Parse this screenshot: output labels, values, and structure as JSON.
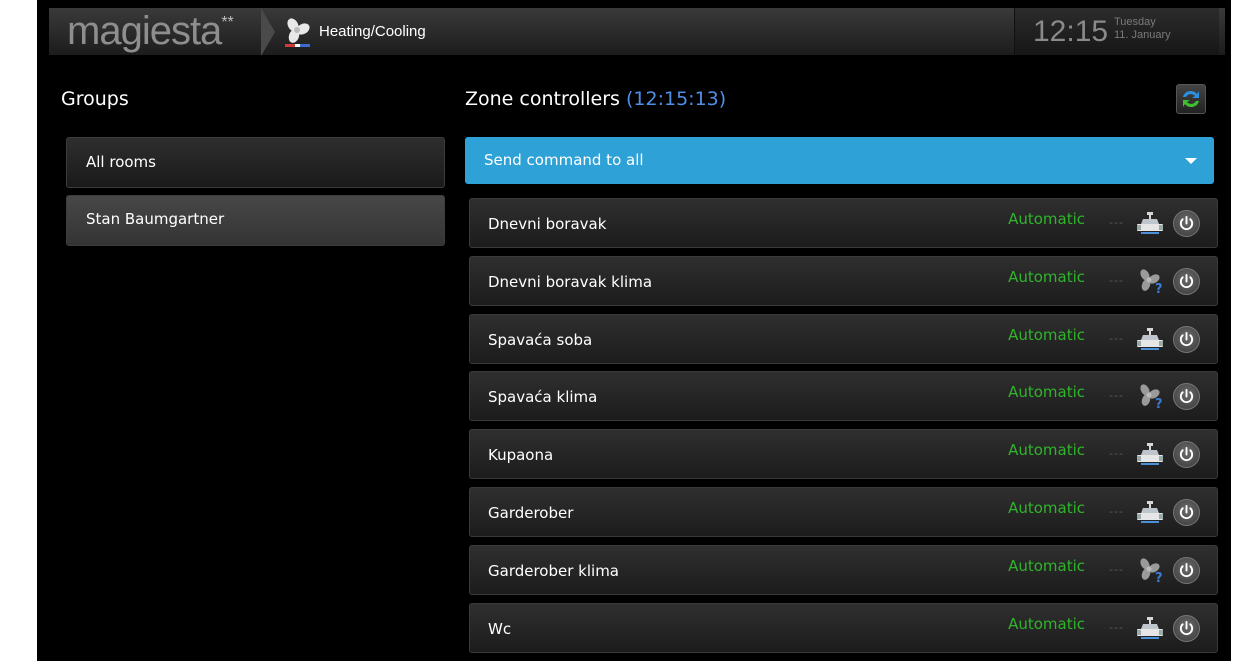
{
  "header": {
    "logo_text": "magiesta",
    "logo_stars": "**",
    "section_title": "Heating/Cooling",
    "section_icon": "fan-icon",
    "clock": {
      "time": "12:15",
      "day": "Tuesday",
      "date": "11. January"
    }
  },
  "groups": {
    "title": "Groups",
    "items": [
      {
        "label": "All rooms",
        "active": false
      },
      {
        "label": "Stan Baumgartner",
        "active": true
      }
    ]
  },
  "zones": {
    "title": "Zone controllers",
    "time": "(12:15:13)",
    "refresh_icon": "refresh-icon",
    "send_all_label": "Send command to all",
    "dashes": "---",
    "status_color": "#2fb42a",
    "items": [
      {
        "name": "Dnevni boravak",
        "status": "Automatic",
        "device": "valve-icon"
      },
      {
        "name": "Dnevni boravak klima",
        "status": "Automatic",
        "device": "fan-unknown-icon"
      },
      {
        "name": "Spavaća soba",
        "status": "Automatic",
        "device": "valve-icon"
      },
      {
        "name": "Spavaća klima",
        "status": "Automatic",
        "device": "fan-unknown-icon"
      },
      {
        "name": "Kupaona",
        "status": "Automatic",
        "device": "valve-icon"
      },
      {
        "name": "Garderober",
        "status": "Automatic",
        "device": "valve-icon"
      },
      {
        "name": "Garderober klima",
        "status": "Automatic",
        "device": "fan-unknown-icon"
      },
      {
        "name": "Wc",
        "status": "Automatic",
        "device": "valve-icon"
      }
    ]
  },
  "colors": {
    "accent": "#2ea1d7",
    "time_highlight": "#4f8fe8",
    "status": "#2fb42a"
  }
}
